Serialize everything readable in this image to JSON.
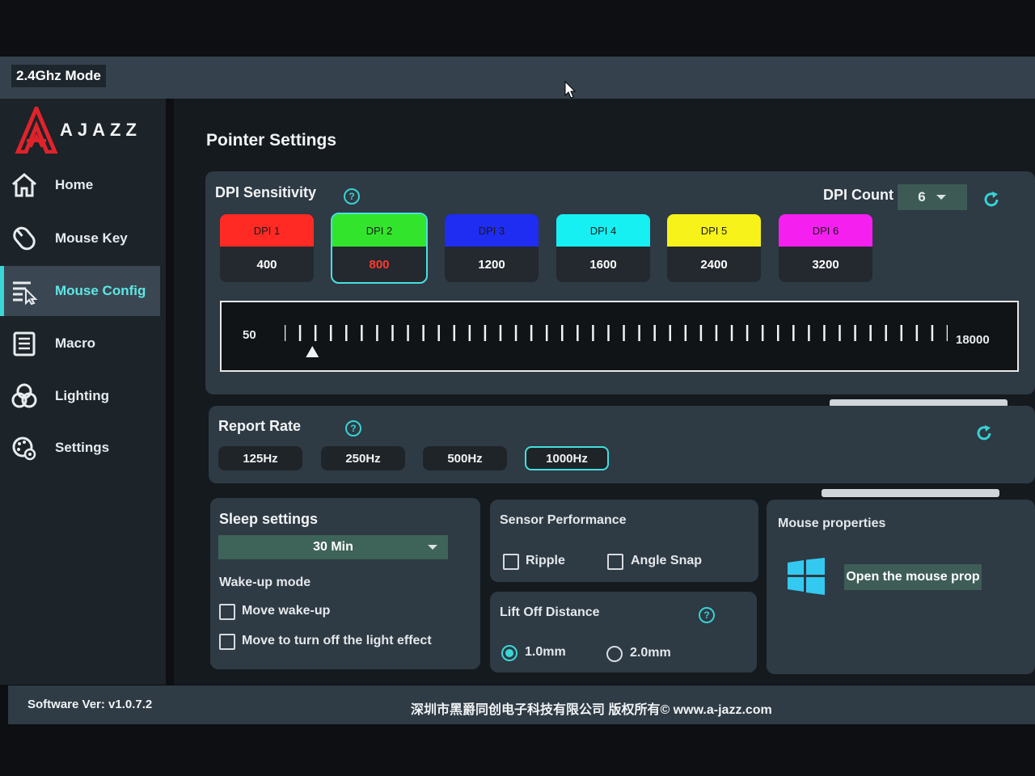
{
  "window": {
    "mode_badge": "2.4Ghz Mode"
  },
  "brand": {
    "logo_text": "AJAZZ",
    "accent": "#e0232b"
  },
  "sidebar": {
    "items": [
      {
        "label": "Home",
        "icon": "home-icon"
      },
      {
        "label": "Mouse Key",
        "icon": "mouse-icon"
      },
      {
        "label": "Mouse Config",
        "icon": "mouse-config-icon",
        "active": true
      },
      {
        "label": "Macro",
        "icon": "macro-icon"
      },
      {
        "label": "Lighting",
        "icon": "lighting-icon"
      },
      {
        "label": "Settings",
        "icon": "settings-icon"
      }
    ]
  },
  "page": {
    "title": "Pointer Settings"
  },
  "dpi": {
    "title": "DPI Sensitivity",
    "count_label": "DPI Count",
    "count_value": "6",
    "cards": [
      {
        "label": "DPI 1",
        "value": "400",
        "color": "#ff2a24",
        "value_color": "#ffffff"
      },
      {
        "label": "DPI 2",
        "value": "800",
        "color": "#32e52c",
        "value_color": "#ff3b30",
        "selected": true
      },
      {
        "label": "DPI 3",
        "value": "1200",
        "color": "#1f2cf2",
        "value_color": "#ffffff"
      },
      {
        "label": "DPI 4",
        "value": "1600",
        "color": "#16f0f2",
        "value_color": "#ffffff"
      },
      {
        "label": "DPI 5",
        "value": "2400",
        "color": "#f6f21a",
        "value_color": "#ffffff"
      },
      {
        "label": "DPI 6",
        "value": "3200",
        "color": "#f51ff0",
        "value_color": "#ffffff"
      }
    ],
    "slider_min": "50",
    "slider_max": "18000",
    "slider_value": 800
  },
  "report_rate": {
    "title": "Report Rate",
    "options": [
      "125Hz",
      "250Hz",
      "500Hz",
      "1000Hz"
    ],
    "selected": "1000Hz"
  },
  "sleep": {
    "title": "Sleep settings",
    "value": "30 Min",
    "wake_title": "Wake-up mode",
    "options": [
      "Move wake-up",
      "Move to turn off the light effect"
    ]
  },
  "sensor": {
    "title": "Sensor Performance",
    "options": [
      "Ripple",
      "Angle Snap"
    ]
  },
  "lift_off": {
    "title": "Lift Off Distance",
    "options": [
      "1.0mm",
      "2.0mm"
    ],
    "selected": "1.0mm"
  },
  "mouse_props": {
    "title": "Mouse properties",
    "button_label": "Open the mouse prop"
  },
  "footer": {
    "version": "Software Ver: v1.0.7.2",
    "copyright": "深圳市黑爵同创电子科技有限公司 版权所有© www.a-jazz.com"
  }
}
